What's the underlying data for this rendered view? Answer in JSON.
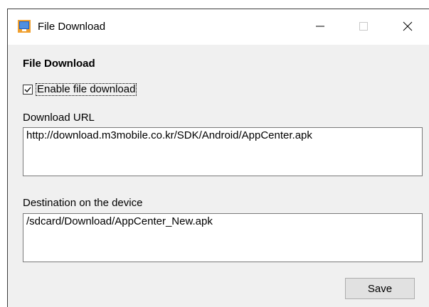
{
  "window": {
    "title": "File Download",
    "controls": {
      "minimize_icon": "minimize-icon",
      "maximize_icon": "maximize-icon",
      "close_icon": "close-icon"
    }
  },
  "content": {
    "section_title": "File Download",
    "enable_checkbox": {
      "label": "Enable file download",
      "checked": true
    },
    "download_url": {
      "label": "Download URL",
      "value": "http://download.m3mobile.co.kr/SDK/Android/AppCenter.apk"
    },
    "destination": {
      "label": "Destination on the device",
      "value": "/sdcard/Download/AppCenter_New.apk"
    },
    "save_label": "Save"
  },
  "colors": {
    "titlebar_bg": "#ffffff",
    "client_bg": "#f0f0f0",
    "button_bg": "#e1e1e1",
    "icon_blue": "#1f5fbf",
    "icon_orange": "#f0a030"
  }
}
